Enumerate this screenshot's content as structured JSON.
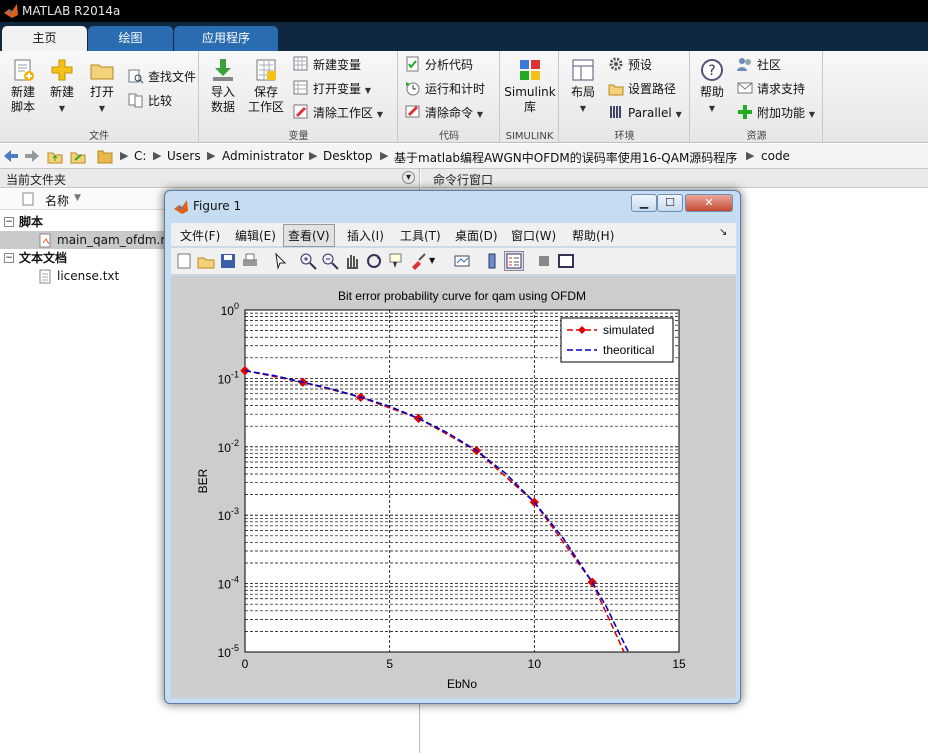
{
  "window": {
    "title": "MATLAB R2014a"
  },
  "tabs": [
    {
      "label": "主页"
    },
    {
      "label": "绘图"
    },
    {
      "label": "应用程序"
    }
  ],
  "ribbon": {
    "file_group": {
      "label": "文件",
      "new_script": "新建\n脚本",
      "new_script_l1": "新建",
      "new_script_l2": "脚本",
      "new": "新建",
      "open": "打开",
      "find_files": "查找文件",
      "compare": "比较"
    },
    "variable_group": {
      "label": "变量",
      "import_l1": "导入",
      "import_l2": "数据",
      "save_l1": "保存",
      "save_l2": "工作区",
      "new_variable": "新建变量",
      "open_variable": "打开变量",
      "clear_workspace": "清除工作区"
    },
    "code_group": {
      "label": "代码",
      "analyze": "分析代码",
      "run_time": "运行和计时",
      "clear_commands": "清除命令"
    },
    "simulink_group": {
      "label": "SIMULINK",
      "simulink_l1": "Simulink",
      "simulink_l2": "库"
    },
    "env_group": {
      "label": "环境",
      "layout": "布局",
      "preferences": "预设",
      "set_path": "设置路径",
      "parallel": "Parallel"
    },
    "resources_group": {
      "label": "资源",
      "help": "帮助",
      "community": "社区",
      "request_support": "请求支持",
      "addons": "附加功能"
    }
  },
  "address": {
    "crumbs": [
      "C:",
      "Users",
      "Administrator",
      "Desktop",
      "基于matlab编程AWGN中OFDM的误码率使用16-QAM源码程序",
      "code"
    ]
  },
  "current_folder": {
    "title": "当前文件夹",
    "column_name": "名称",
    "sections": [
      {
        "label": "脚本",
        "files": [
          "main_qam_ofdm.m"
        ]
      },
      {
        "label": "文本文档",
        "files": [
          "license.txt"
        ]
      }
    ]
  },
  "command_window": {
    "title": "命令行窗口"
  },
  "figure": {
    "title": "Figure 1",
    "menu": [
      "文件(F)",
      "编辑(E)",
      "查看(V)",
      "插入(I)",
      "工具(T)",
      "桌面(D)",
      "窗口(W)",
      "帮助(H)"
    ]
  },
  "chart_data": {
    "type": "line",
    "title": "Bit error probability curve for qam using OFDM",
    "xlabel": "EbNo",
    "ylabel": "BER",
    "xlim": [
      0,
      15
    ],
    "ylim": [
      1e-05,
      1
    ],
    "yscale": "log",
    "grid": true,
    "legend_position": "top-right",
    "x_ticks": [
      "0",
      "5",
      "10",
      "15"
    ],
    "y_ticks": [
      "10^0",
      "10^-1",
      "10^-2",
      "10^-3",
      "10^-4",
      "10^-5"
    ],
    "series": [
      {
        "name": "simulated",
        "color": "#e00000",
        "style": "dashed",
        "marker": "diamond",
        "x": [
          0,
          2,
          4,
          6,
          8,
          10,
          12,
          13.1
        ],
        "y": [
          0.13,
          0.088,
          0.053,
          0.026,
          0.0088,
          0.00155,
          0.000105,
          1e-05
        ]
      },
      {
        "name": "theoritical",
        "color": "#0000cc",
        "style": "dashed",
        "marker": "none",
        "x": [
          0,
          1,
          2,
          3,
          4,
          5,
          6,
          7,
          8,
          9,
          10,
          11,
          12,
          12.5,
          13.25
        ],
        "y": [
          0.13,
          0.11,
          0.088,
          0.07,
          0.053,
          0.039,
          0.026,
          0.016,
          0.0088,
          0.0041,
          0.00155,
          0.00046,
          0.000105,
          4.5e-05,
          1e-05
        ]
      }
    ]
  }
}
